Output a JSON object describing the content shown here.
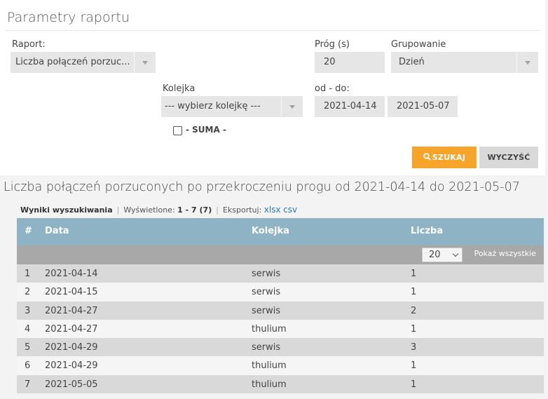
{
  "panel": {
    "title": "Parametry raportu",
    "report_label": "Raport:",
    "report_value": "Liczba połączeń porzuc...",
    "threshold_label": "Próg (s)",
    "threshold_value": "20",
    "grouping_label": "Grupowanie",
    "grouping_value": "Dzień",
    "queue_label": "Kolejka",
    "queue_value": "--- wybierz kolejkę ---",
    "range_label": "od - do:",
    "date_from": "2021-04-14",
    "date_to": "2021-05-07",
    "sum_label": "- SUMA -",
    "search_button": "SZUKAJ",
    "clear_button": "WYCZYŚĆ"
  },
  "report": {
    "title": "Liczba połączeń porzuconych po przekroczeniu progu od 2021-04-14 do 2021-05-07",
    "results_label": "Wyniki wyszukiwania",
    "shown_label": "Wyświetlone:",
    "shown_value": "1 - 7 (7)",
    "export_label": "Eksportuj:",
    "export_xlsx": "xlsx",
    "export_csv": "csv"
  },
  "table": {
    "headers": {
      "num": "#",
      "date": "Data",
      "queue": "Kolejka",
      "count": "Liczba"
    },
    "page_size": "20",
    "show_all": "Pokaż wszystkie",
    "rows": [
      {
        "num": "1",
        "date": "2021-04-14",
        "queue": "serwis",
        "count": "1"
      },
      {
        "num": "2",
        "date": "2021-04-15",
        "queue": "serwis",
        "count": "1"
      },
      {
        "num": "3",
        "date": "2021-04-27",
        "queue": "serwis",
        "count": "2"
      },
      {
        "num": "4",
        "date": "2021-04-27",
        "queue": "thulium",
        "count": "1"
      },
      {
        "num": "5",
        "date": "2021-04-29",
        "queue": "serwis",
        "count": "3"
      },
      {
        "num": "6",
        "date": "2021-04-29",
        "queue": "thulium",
        "count": "1"
      },
      {
        "num": "7",
        "date": "2021-05-05",
        "queue": "thulium",
        "count": "1"
      }
    ]
  },
  "colors": {
    "accent": "#f7a42b",
    "table_header": "#8db3c4",
    "link": "#2a7ab8"
  }
}
